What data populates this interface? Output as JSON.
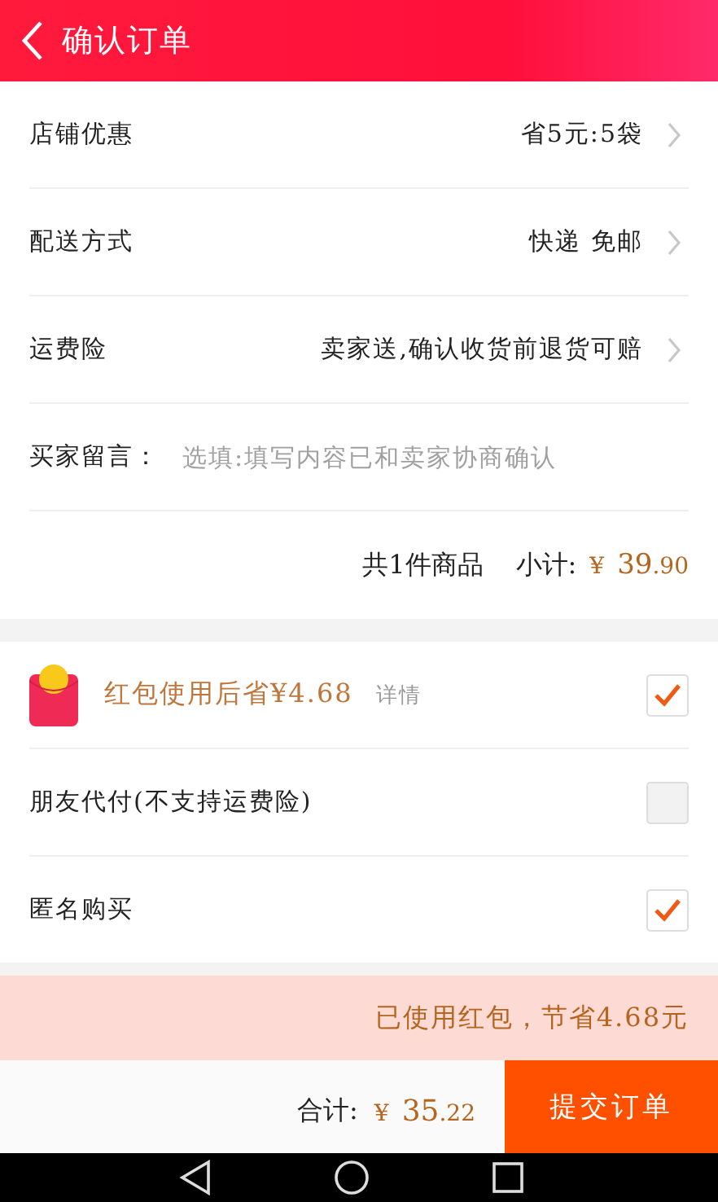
{
  "header": {
    "title": "确认订单"
  },
  "order_rows": [
    {
      "kind": "link",
      "label": "店铺优惠",
      "value": "省5元:5袋"
    },
    {
      "kind": "link",
      "label": "配送方式",
      "value": "快递 免邮"
    },
    {
      "kind": "link",
      "label": "运费险",
      "value": "卖家送,确认收货前退货可赔"
    },
    {
      "kind": "input",
      "label": "买家留言：",
      "placeholder": "选填:填写内容已和卖家协商确认"
    }
  ],
  "subtotal": {
    "count": "共1件商品",
    "label": "小计:",
    "currency": "¥",
    "whole": "39",
    "fraction": ".90"
  },
  "options": [
    {
      "kind": "redpacket",
      "label": "红包使用后省¥4.68",
      "detail": "详情",
      "checked": true
    },
    {
      "kind": "plain",
      "label": "朋友代付(不支持运费险)",
      "checked": false
    },
    {
      "kind": "plain",
      "label": "匿名购买",
      "checked": true
    }
  ],
  "notice": "已使用红包，节省4.68元",
  "footer": {
    "label": "合计:",
    "currency": "¥",
    "whole": "35",
    "fraction": ".22",
    "submit": "提交订单"
  }
}
